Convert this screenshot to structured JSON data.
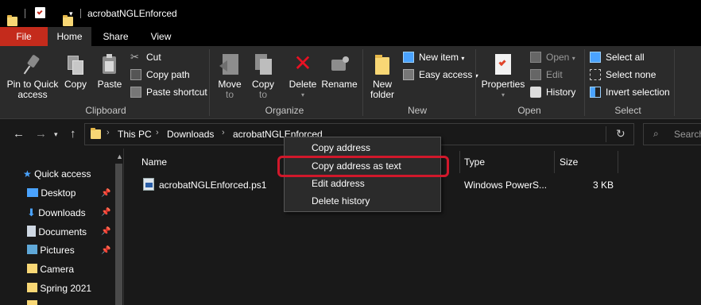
{
  "window": {
    "title": "acrobatNGLEnforced"
  },
  "tabs": [
    "File",
    "Home",
    "Share",
    "View"
  ],
  "ribbon": {
    "clipboard": {
      "label": "Clipboard",
      "pin": "Pin to Quick access",
      "pin_line1": "Pin to Quick",
      "pin_line2": "access",
      "copy": "Copy",
      "paste": "Paste",
      "cut": "Cut",
      "copy_path": "Copy path",
      "paste_shortcut": "Paste shortcut"
    },
    "organize": {
      "label": "Organize",
      "move_to_line1": "Move",
      "move_to_line2": "to",
      "copy_to_line1": "Copy",
      "copy_to_line2": "to",
      "delete": "Delete",
      "rename": "Rename"
    },
    "new": {
      "label": "New",
      "new_folder_line1": "New",
      "new_folder_line2": "folder",
      "new_item": "New item",
      "easy_access": "Easy access"
    },
    "open": {
      "label": "Open",
      "properties": "Properties",
      "open": "Open",
      "edit": "Edit",
      "history": "History"
    },
    "select": {
      "label": "Select",
      "select_all": "Select all",
      "select_none": "Select none",
      "invert_selection": "Invert selection"
    }
  },
  "address": {
    "crumbs": [
      "This PC",
      "Downloads",
      "acrobatNGLEnforced"
    ],
    "search_placeholder": "Search"
  },
  "navpane": {
    "items": [
      {
        "label": "Quick access",
        "icon": "star-icon",
        "pinned": false
      },
      {
        "label": "Desktop",
        "icon": "desktop-icon",
        "pinned": true
      },
      {
        "label": "Downloads",
        "icon": "download-icon",
        "pinned": true
      },
      {
        "label": "Documents",
        "icon": "document-icon",
        "pinned": true
      },
      {
        "label": "Pictures",
        "icon": "picture-icon",
        "pinned": true
      },
      {
        "label": "Camera",
        "icon": "folder-icon",
        "pinned": false
      },
      {
        "label": "Spring 2021",
        "icon": "folder-icon",
        "pinned": false
      }
    ]
  },
  "content": {
    "columns": {
      "name": "Name",
      "type": "Type",
      "size": "Size"
    },
    "files": [
      {
        "name": "acrobatNGLEnforced.ps1",
        "type": "Windows PowerS...",
        "size": "3 KB"
      }
    ]
  },
  "context_menu": {
    "items": [
      "Copy address",
      "Copy address as text",
      "Edit address",
      "Delete history"
    ],
    "highlighted": "Copy address as text",
    "highlight_color": "#d1182b"
  },
  "colors": {
    "file_tab": "#c42b1c",
    "folder": "#f8d775",
    "accent_blue": "#4aa3ff"
  }
}
